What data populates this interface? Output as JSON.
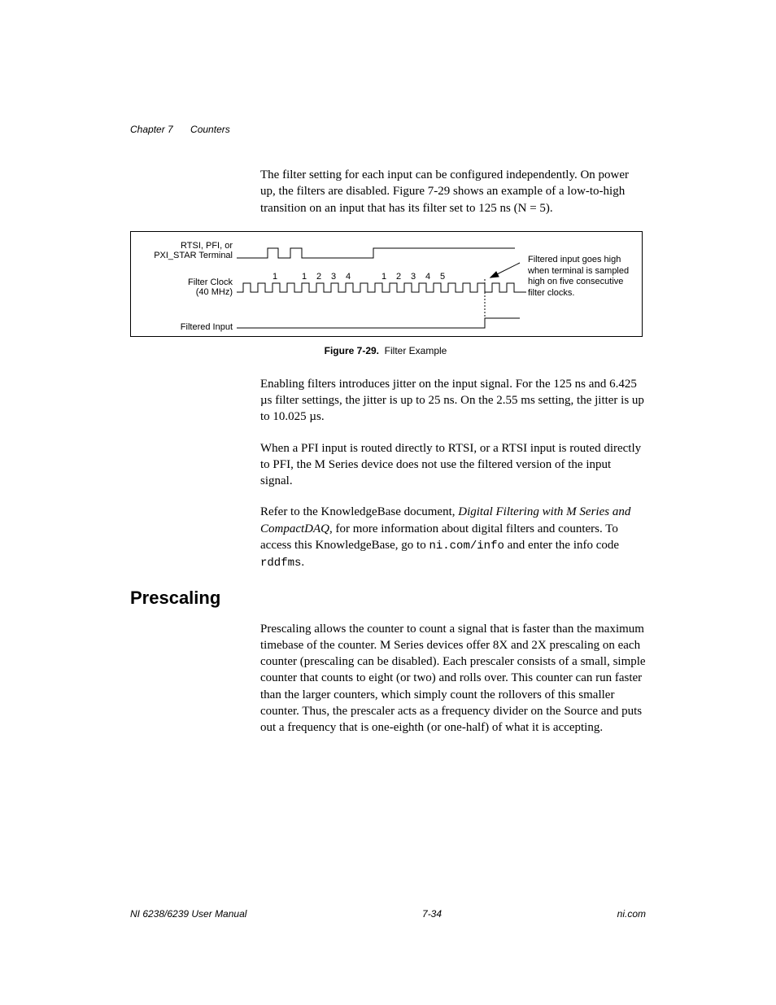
{
  "header": {
    "chapter_label": "Chapter 7",
    "chapter_title": "Counters"
  },
  "paragraphs": {
    "p1": "The filter setting for each input can be configured independently. On power up, the filters are disabled. Figure 7-29 shows an example of a low-to-high transition on an input that has its filter set to 125 ns (N = 5).",
    "p2": "Enabling filters introduces jitter on the input signal. For the 125 ns and 6.425 µs filter settings, the jitter is up to 25 ns. On the 2.55 ms setting, the jitter is up to 10.025 µs.",
    "p3": "When a PFI input is routed directly to RTSI, or a RTSI input is routed directly to PFI, the M Series device does not use the filtered version of the input signal.",
    "p4_pre": "Refer to the KnowledgeBase document, ",
    "p4_em": "Digital Filtering with M Series and CompactDAQ",
    "p4_mid": ", for more information about digital filters and counters. To access this KnowledgeBase, go to ",
    "p4_code1": "ni.com/info",
    "p4_mid2": " and enter the info code ",
    "p4_code2": "rddfms",
    "p4_end": ".",
    "p5": "Prescaling allows the counter to count a signal that is faster than the maximum timebase of the counter. M Series devices offer 8X and 2X prescaling on each counter (prescaling can be disabled). Each prescaler consists of a small, simple counter that counts to eight (or two) and rolls over. This counter can run faster than the larger counters, which simply count the rollovers of this smaller counter. Thus, the prescaler acts as a frequency divider on the Source and puts out a frequency that is one-eighth (or one-half) of what it is accepting."
  },
  "figure": {
    "label_terminal_l1": "RTSI, PFI, or",
    "label_terminal_l2": "PXI_STAR Terminal",
    "label_clock_l1": "Filter Clock",
    "label_clock_l2": "(40 MHz)",
    "label_filtered": "Filtered Input",
    "note_l1": "Filtered input goes high",
    "note_l2": "when terminal is sampled",
    "note_l3": "high on five consecutive",
    "note_l4": "filter clocks.",
    "ticks_a": [
      "1",
      "",
      "1",
      "2",
      "3",
      "4",
      "",
      "1",
      "2",
      "3",
      "4",
      "5"
    ],
    "caption_bold": "Figure 7-29.",
    "caption_rest": "Filter Example"
  },
  "section": {
    "heading": "Prescaling"
  },
  "footer": {
    "left": "NI 6238/6239 User Manual",
    "center": "7-34",
    "right": "ni.com"
  },
  "chart_data": {
    "type": "timing-diagram",
    "signals": [
      {
        "name": "RTSI/PFI/PXI_STAR Terminal",
        "description": "Input terminal signal with glitches then stable high",
        "events": "low, brief high pulse, low, brief high pulse, low, goes high and stays high"
      },
      {
        "name": "Filter Clock (40 MHz)",
        "description": "Continuous square-wave clock, numbered 1..4 then 1..5 on rising edges while terminal high",
        "sequences": [
          [
            1
          ],
          [
            1,
            2,
            3,
            4
          ],
          [
            1,
            2,
            3,
            4,
            5
          ]
        ]
      },
      {
        "name": "Filtered Input",
        "description": "Stays low until terminal sampled high on 5 consecutive filter clocks, then goes high",
        "transition": "low→high after count 5"
      }
    ],
    "N": 5,
    "filter_setting_ns": 125
  }
}
